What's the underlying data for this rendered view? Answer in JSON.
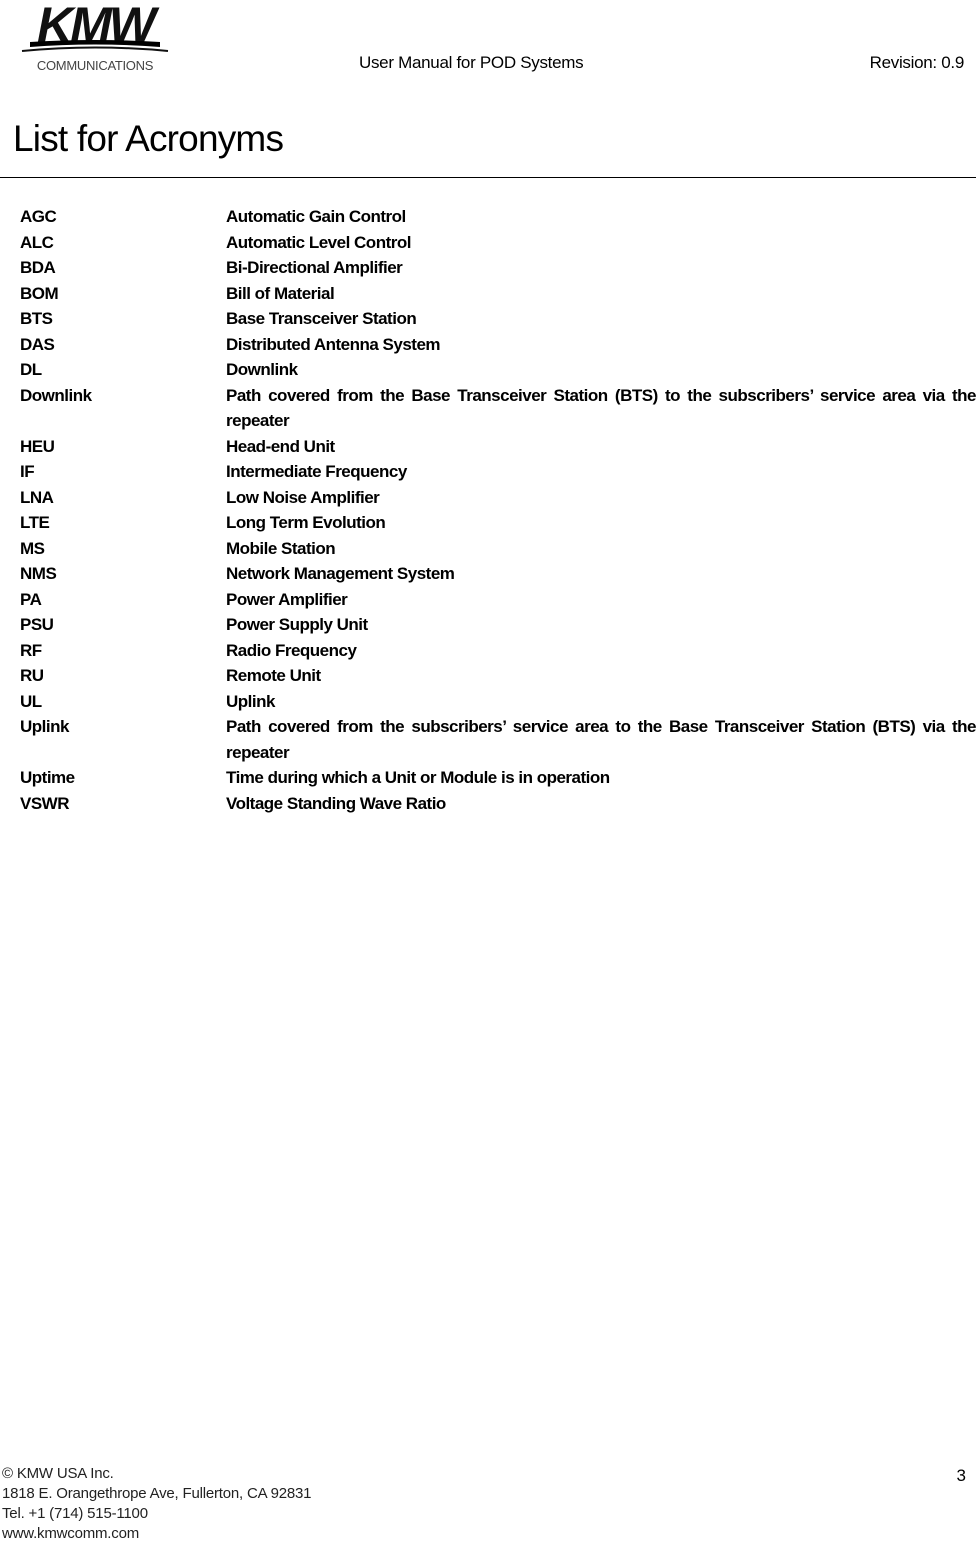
{
  "header": {
    "logo": {
      "brand": "KMW",
      "tagline": "COMMUNICATIONS"
    },
    "title": "User Manual for POD Systems",
    "revision": "Revision: 0.9"
  },
  "page_title": "List for Acronyms",
  "acronyms": [
    {
      "term": "AGC",
      "definition": "Automatic Gain Control"
    },
    {
      "term": "ALC",
      "definition": "Automatic Level Control"
    },
    {
      "term": "BDA",
      "definition": "Bi-Directional Amplifier"
    },
    {
      "term": "BOM",
      "definition": "Bill of Material"
    },
    {
      "term": "BTS",
      "definition": "Base Transceiver Station"
    },
    {
      "term": "DAS",
      "definition": "Distributed Antenna System"
    },
    {
      "term": "DL",
      "definition": "Downlink"
    },
    {
      "term": "Downlink",
      "definition": "Path covered from the Base Transceiver Station (BTS) to the subscribers’ service area via the repeater"
    },
    {
      "term": "HEU",
      "definition": "Head-end Unit"
    },
    {
      "term": "IF",
      "definition": "Intermediate Frequency"
    },
    {
      "term": "LNA",
      "definition": "Low Noise Amplifier"
    },
    {
      "term": "LTE",
      "definition": "Long Term Evolution"
    },
    {
      "term": "MS",
      "definition": "Mobile Station"
    },
    {
      "term": "NMS",
      "definition": "Network Management System"
    },
    {
      "term": "PA",
      "definition": "Power Amplifier"
    },
    {
      "term": "PSU",
      "definition": "Power Supply Unit"
    },
    {
      "term": "RF",
      "definition": "Radio Frequency"
    },
    {
      "term": "RU",
      "definition": "Remote Unit"
    },
    {
      "term": "UL",
      "definition": "Uplink"
    },
    {
      "term": "Uplink",
      "definition": "Path covered from the subscribers’ service area to the Base Transceiver Station (BTS) via the repeater"
    },
    {
      "term": "Uptime",
      "definition": "Time during which a Unit or Module is in operation"
    },
    {
      "term": "VSWR",
      "definition": "Voltage Standing Wave Ratio"
    }
  ],
  "footer": {
    "copyright": "© KMW USA Inc.",
    "address": "1818 E. Orangethrope Ave, Fullerton, CA 92831",
    "phone": "Tel. +1 (714) 515-1100",
    "website": "www.kmwcomm.com",
    "page_number": "3"
  }
}
